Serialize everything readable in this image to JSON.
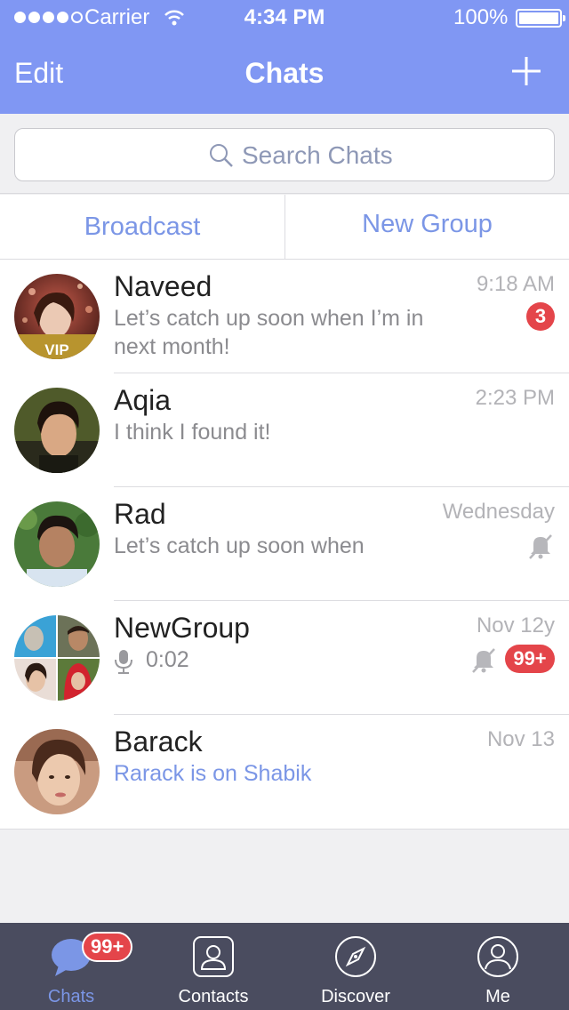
{
  "status": {
    "carrier": "Carrier",
    "time": "4:34 PM",
    "battery": "100%"
  },
  "nav": {
    "edit": "Edit",
    "title": "Chats"
  },
  "search": {
    "placeholder": "Search Chats"
  },
  "actions": {
    "broadcast": "Broadcast",
    "new_group": "New Group"
  },
  "chats": [
    {
      "name": "Naveed",
      "preview": "Let’s catch up soon when I’m in next month!",
      "time": "9:18 AM",
      "badge": "3",
      "vip": "VIP"
    },
    {
      "name": "Aqia",
      "preview": "I think I found it!",
      "time": "2:23 PM"
    },
    {
      "name": "Rad",
      "preview": "Let’s catch up soon when",
      "time": "Wednesday",
      "muted": true
    },
    {
      "name": "NewGroup",
      "preview": "0:02",
      "time": "Nov 12y",
      "muted": true,
      "badge": "99+"
    },
    {
      "name": "Barack",
      "preview": "Rarack is on Shabik",
      "time": "Nov 13"
    }
  ],
  "tabs": [
    {
      "label": "Chats",
      "badge": "99+",
      "active": true
    },
    {
      "label": "Contacts"
    },
    {
      "label": "Discover"
    },
    {
      "label": "Me"
    }
  ],
  "colors": {
    "header": "#8097f3",
    "accent": "#7b96e6",
    "badge": "#e4454a",
    "tabbar": "#4a4c5f"
  }
}
